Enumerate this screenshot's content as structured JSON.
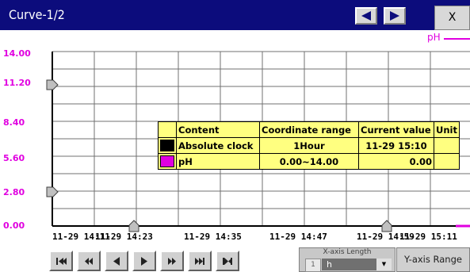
{
  "window": {
    "title": "Curve-1/2",
    "close_label": "X",
    "titlebar_color": "#0c0c7c"
  },
  "series_legend": {
    "label": "pH",
    "color": "#e000e0"
  },
  "y_axis": {
    "labels": [
      "14.00",
      "11.20",
      "8.40",
      "5.60",
      "2.80",
      "0.00"
    ]
  },
  "x_axis": {
    "labels": [
      "11-29 14:11",
      "11-29 14:23",
      "11-29 14:35",
      "11-29 14:47",
      "11-29 14:59",
      "11-29 15:11"
    ]
  },
  "info_table": {
    "headers": [
      "Content",
      "Coordinate range",
      "Current value",
      "Unit"
    ],
    "rows": [
      {
        "name": "Absolute clock",
        "range": "1Hour",
        "value": "11-29 15:10",
        "unit": "",
        "color": "#000000"
      },
      {
        "name": "pH",
        "range": "0.00~14.00",
        "value": "0.00",
        "unit": "",
        "color": "#e000e0"
      }
    ]
  },
  "playback_buttons": [
    {
      "icon": "first-page-icon"
    },
    {
      "icon": "fast-rewind-icon"
    },
    {
      "icon": "step-back-icon"
    },
    {
      "icon": "play-icon"
    },
    {
      "icon": "fast-forward-icon"
    },
    {
      "icon": "skip-to-end-icon"
    },
    {
      "icon": "last-page-icon"
    }
  ],
  "x_axis_length": {
    "label": "X-axis Length",
    "value": "1",
    "unit": "h",
    "dropdown_icon": "chevron-down-icon"
  },
  "y_axis_range_button": "Y-axis Range"
}
